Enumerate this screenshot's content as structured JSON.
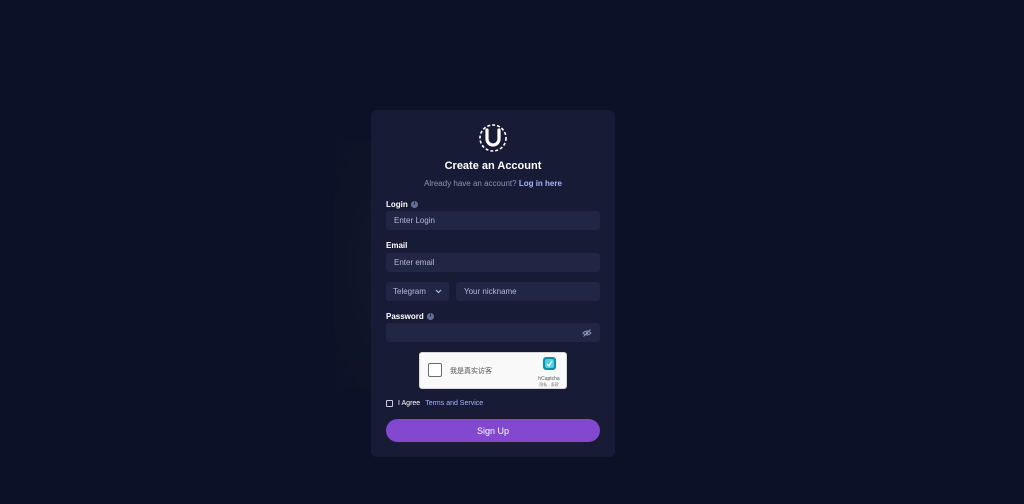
{
  "header": {
    "title": "Create an Account",
    "subtitle_text": "Already have an account?",
    "login_link": "Log in here"
  },
  "form": {
    "login_label": "Login",
    "login_placeholder": "Enter Login",
    "email_label": "Email",
    "email_placeholder": "Enter email",
    "contact_select": "Telegram",
    "nickname_placeholder": "Your nickname",
    "password_label": "Password",
    "password_value": ""
  },
  "captcha": {
    "text": "我是真实访客",
    "brand": "hCaptcha",
    "links": "隐私 - 条款"
  },
  "agree": {
    "prefix": "I Agree",
    "link": "Terms and Service"
  },
  "submit_label": "Sign Up",
  "colors": {
    "background": "#0d1128",
    "card": "#181b36",
    "input": "#222645",
    "accent": "#8348d0",
    "link": "#a7b4ff"
  },
  "icons": [
    "logo-icon",
    "info-icon",
    "chevron-down-icon",
    "eye-off-icon",
    "hcaptcha-logo-icon"
  ]
}
